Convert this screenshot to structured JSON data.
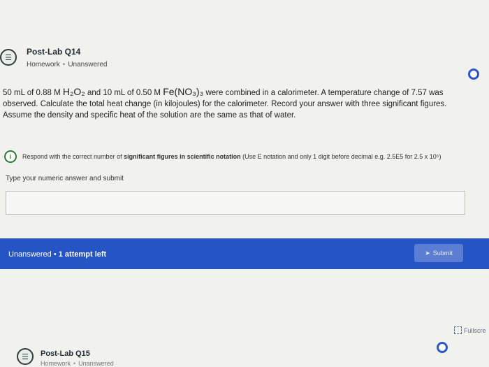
{
  "question1": {
    "icon": "question-list-icon",
    "title": "Post-Lab Q14",
    "type": "Homework",
    "status": "Unanswered"
  },
  "problem": {
    "part1": "50 mL of 0.88 M ",
    "chem1": "H₂O₂",
    "part2": " and 10 mL of 0.50 M ",
    "chem2": "Fe(NO₃)₃",
    "part3": " were combined in a calorimeter. A temperature change of 7.57 was observed. Calculate the total heat change (in kilojoules) for the calorimeter. Record your answer with three significant figures. Assume the density and specific heat of the solution are the same as that of water."
  },
  "hint": {
    "icon": "info-icon",
    "lead": "Respond with the correct number of ",
    "bold": "significant figures in scientific notation",
    "tail": " (Use E notation and only 1 digit before decimal e.g. 2.5E5 for 2.5 x 10⁵)"
  },
  "answer": {
    "label": "Type your numeric answer and submit",
    "value": ""
  },
  "status_bar": {
    "status": "Unanswered",
    "separator": "•",
    "attempts": "1 attempt left",
    "submit_label": "Submit",
    "submit_icon": "send-icon"
  },
  "fullscreen": {
    "label": "Fullscre",
    "icon": "fullscreen-icon"
  },
  "question2": {
    "icon": "question-list-icon",
    "title": "Post-Lab Q15",
    "type": "Homework",
    "status": "Unanswered"
  },
  "colors": {
    "accent": "#2555c4",
    "submit_bg": "#5b7ed4",
    "background": "#f1f1ee"
  }
}
